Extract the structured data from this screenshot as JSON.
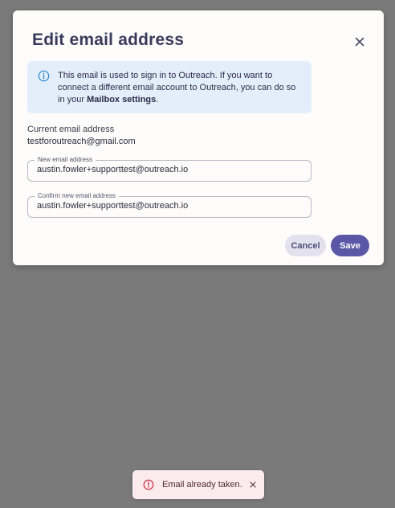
{
  "modal": {
    "title": "Edit email address",
    "close_icon": "close-icon",
    "info": {
      "icon": "info-icon",
      "text": "This email is used to sign in to Outreach. If you want to connect a different email account to Outreach, you can do so in your ",
      "link_text": "Mailbox settings",
      "suffix": "."
    },
    "current_email": {
      "label": "Current email address",
      "value": "testforoutreach@gmail.com"
    },
    "new_email": {
      "label": "New email address",
      "value": "austin.fowler+supporttest@outreach.io"
    },
    "confirm_email": {
      "label": "Confirm new email address",
      "value": "austin.fowler+supporttest@outreach.io"
    },
    "buttons": {
      "cancel": "Cancel",
      "save": "Save"
    }
  },
  "toast": {
    "icon": "error-icon",
    "message": "Email already taken.",
    "close_icon": "close-icon"
  },
  "colors": {
    "overlay": "#7a7a7a",
    "modal_bg": "#fdfcfb",
    "info_bg": "#e3eefb",
    "primary": "#5a57a6",
    "secondary_button_bg": "#e3e1ee",
    "toast_bg": "#fcebec",
    "error": "#d0344a",
    "info_icon": "#2a86c8"
  }
}
